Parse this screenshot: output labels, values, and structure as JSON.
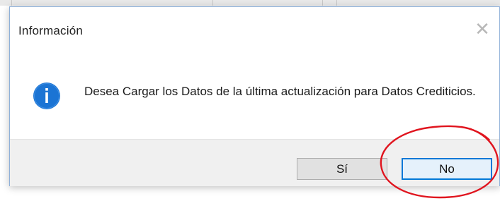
{
  "dialog": {
    "title": "Información",
    "close_symbol": "✕",
    "message": "Desea Cargar los Datos de la última actualización para Datos Crediticios.",
    "icon": "info-icon",
    "buttons": {
      "yes_label": "Sí",
      "no_label": "No"
    }
  },
  "annotation": {
    "shape": "ellipse",
    "color": "#e0141e",
    "target": "no-button"
  },
  "colors": {
    "info_icon_blue": "#1b74d4",
    "focus_border": "#0078d7",
    "footer_bg": "#f0f0f0"
  }
}
